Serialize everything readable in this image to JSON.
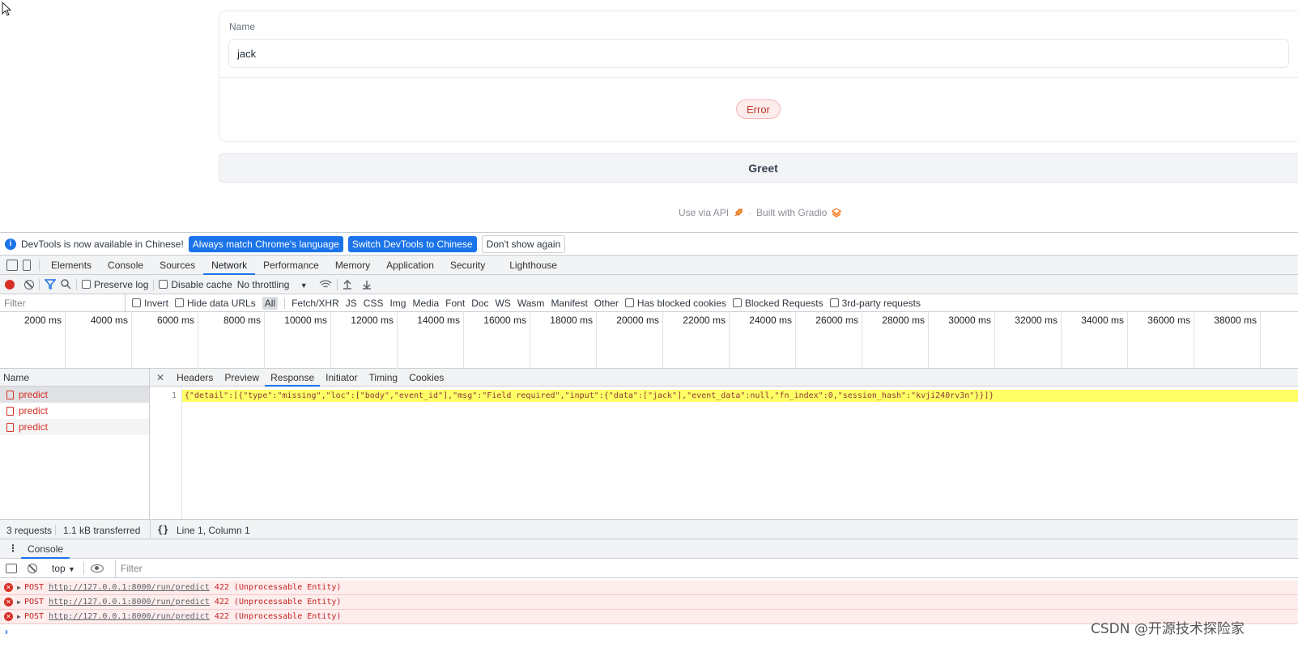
{
  "gradio": {
    "name_label": "Name",
    "name_value": "jack",
    "error_badge": "Error",
    "greet_button": "Greet",
    "footer_api": "Use via API",
    "footer_sep": "·",
    "footer_built": "Built with Gradio"
  },
  "infobar": {
    "message": "DevTools is now available in Chinese!",
    "btn_match": "Always match Chrome's language",
    "btn_switch": "Switch DevTools to Chinese",
    "btn_dismiss": "Don't show again"
  },
  "tabs": [
    "Elements",
    "Console",
    "Sources",
    "Network",
    "Performance",
    "Memory",
    "Application",
    "Security",
    "Lighthouse"
  ],
  "active_tab": "Network",
  "toolbar": {
    "preserve_log": "Preserve log",
    "disable_cache": "Disable cache",
    "throttling": "No throttling"
  },
  "filterbar": {
    "placeholder": "Filter",
    "invert": "Invert",
    "hide_data_urls": "Hide data URLs",
    "types": [
      "All",
      "Fetch/XHR",
      "JS",
      "CSS",
      "Img",
      "Media",
      "Font",
      "Doc",
      "WS",
      "Wasm",
      "Manifest",
      "Other"
    ],
    "has_blocked_cookies": "Has blocked cookies",
    "blocked_requests": "Blocked Requests",
    "third_party": "3rd-party requests"
  },
  "timeline_labels": [
    "2000 ms",
    "4000 ms",
    "6000 ms",
    "8000 ms",
    "10000 ms",
    "12000 ms",
    "14000 ms",
    "16000 ms",
    "18000 ms",
    "20000 ms",
    "22000 ms",
    "24000 ms",
    "26000 ms",
    "28000 ms",
    "30000 ms",
    "32000 ms",
    "34000 ms",
    "36000 ms",
    "38000 ms"
  ],
  "requests": {
    "header": "Name",
    "items": [
      "predict",
      "predict",
      "predict"
    ]
  },
  "detail_tabs": [
    "Headers",
    "Preview",
    "Response",
    "Initiator",
    "Timing",
    "Cookies"
  ],
  "active_detail_tab": "Response",
  "response": {
    "line_number": "1",
    "body": "{\"detail\":[{\"type\":\"missing\",\"loc\":[\"body\",\"event_id\"],\"msg\":\"Field required\",\"input\":{\"data\":[\"jack\"],\"event_data\":null,\"fn_index\":0,\"session_hash\":\"kvji240rv3n\"}}]}"
  },
  "status": {
    "requests": "3 requests",
    "transferred": "1.1 kB transferred",
    "brace": "{}",
    "position": "Line 1, Column 1"
  },
  "console": {
    "tab": "Console",
    "context": "top",
    "filter": "Filter",
    "messages": [
      {
        "method": "POST",
        "url": "http://127.0.0.1:8000/run/predict",
        "status": "422 (Unprocessable Entity)"
      },
      {
        "method": "POST",
        "url": "http://127.0.0.1:8000/run/predict",
        "status": "422 (Unprocessable Entity)"
      },
      {
        "method": "POST",
        "url": "http://127.0.0.1:8000/run/predict",
        "status": "422 (Unprocessable Entity)"
      }
    ]
  },
  "watermark": "CSDN @开源技术探险家"
}
